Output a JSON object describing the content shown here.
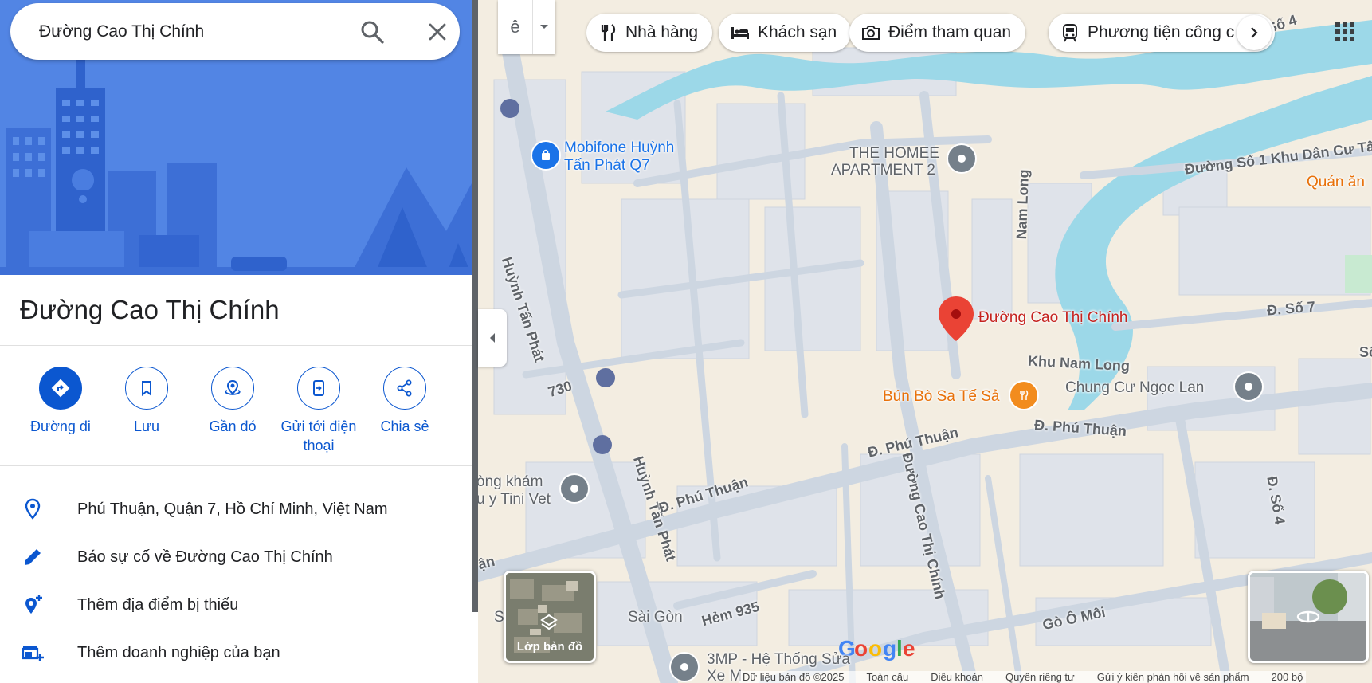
{
  "search": {
    "value": "Đường Cao Thị Chính"
  },
  "place": {
    "title": "Đường Cao Thị Chính"
  },
  "actions": [
    {
      "label": "Đường đi",
      "icon": "directions-icon"
    },
    {
      "label": "Lưu",
      "icon": "bookmark-icon"
    },
    {
      "label": "Gần đó",
      "icon": "nearby-icon"
    },
    {
      "label": "Gửi tới điện thoại",
      "icon": "send-to-phone-icon"
    },
    {
      "label": "Chia sẻ",
      "icon": "share-icon"
    }
  ],
  "info": [
    {
      "text": "Phú Thuận, Quận 7, Hồ Chí Minh, Việt Nam",
      "icon": "location-pin-icon"
    },
    {
      "text": "Báo sự cố về Đường Cao Thị Chính",
      "icon": "edit-pencil-icon"
    },
    {
      "text": "Thêm địa điểm bị thiếu",
      "icon": "add-location-icon"
    },
    {
      "text": "Thêm doanh nghiệp của bạn",
      "icon": "add-business-icon"
    }
  ],
  "map_toolbar": {
    "input_tool": "ê"
  },
  "chips": [
    {
      "label": "Nhà hàng",
      "icon": "restaurant-icon"
    },
    {
      "label": "Khách sạn",
      "icon": "hotel-icon"
    },
    {
      "label": "Điểm tham quan",
      "icon": "camera-icon"
    },
    {
      "label": "Phương tiện công c",
      "icon": "transit-icon"
    }
  ],
  "map_labels": {
    "selected": "Đường Cao Thị Chính",
    "mobifone_1": "Mobifone Huỳnh",
    "mobifone_2": "Tấn Phát Q7",
    "homee_1": "THE HOMEE",
    "homee_2": "APARTMENT 2",
    "bun_bo": "Bún Bò Sa Tế Sả",
    "chung_cu": "Chung Cư Ngọc Lan",
    "phong_kham_1": "òng khám",
    "phong_kham_2": "u y Tini Vet",
    "sai_gon": "Sài Gòn",
    "s_left": "S",
    "three_mp_1": "3MP - Hệ Thống Sửa",
    "three_mp_2": "Xe M",
    "quan_an": "Quán ăn",
    "khu_dan_cu": "Đường Số 1 Khu Dân Cư Tâ",
    "so4_top": "Số 4"
  },
  "streets": {
    "huynh_tan_phat_1": "Huỳnh Tấn Phát",
    "huynh_tan_phat_2": "Huỳnh Tấn Phát",
    "phu_thuan_1": "Đ. Phú Thuận",
    "phu_thuan_2": "Đ. Phú Thuận",
    "phu_thuan_3": "Đ. Phú Thuận",
    "cao_thi_chinh": "Đường Cao Thị Chính",
    "nam_long": "Nam Long",
    "khu_nam_long": "Khu Nam Long",
    "so7": "Đ. Số 7",
    "so4": "Đ. Số 4",
    "s730": "730",
    "hem935": "Hẻm 935",
    "go_o_moi": "Gò Ô Môi",
    "an_left": "ận",
    "so_right": "Số"
  },
  "layers": {
    "label": "Lớp bản đồ"
  },
  "footer": {
    "items": [
      "Dữ liệu bản đồ ©2025",
      "Toàn cầu",
      "Điều khoản",
      "Quyền riêng tư",
      "Gửi ý kiến phản hồi về sản phẩm",
      "200 bộ"
    ]
  },
  "logo": "Google",
  "colors": {
    "accent": "#0b57d0",
    "marker": "#ea4335",
    "water": "#9cd8e8",
    "poi_grey": "#75808a",
    "food": "#f28c1e",
    "selected_label": "#c5221f"
  }
}
